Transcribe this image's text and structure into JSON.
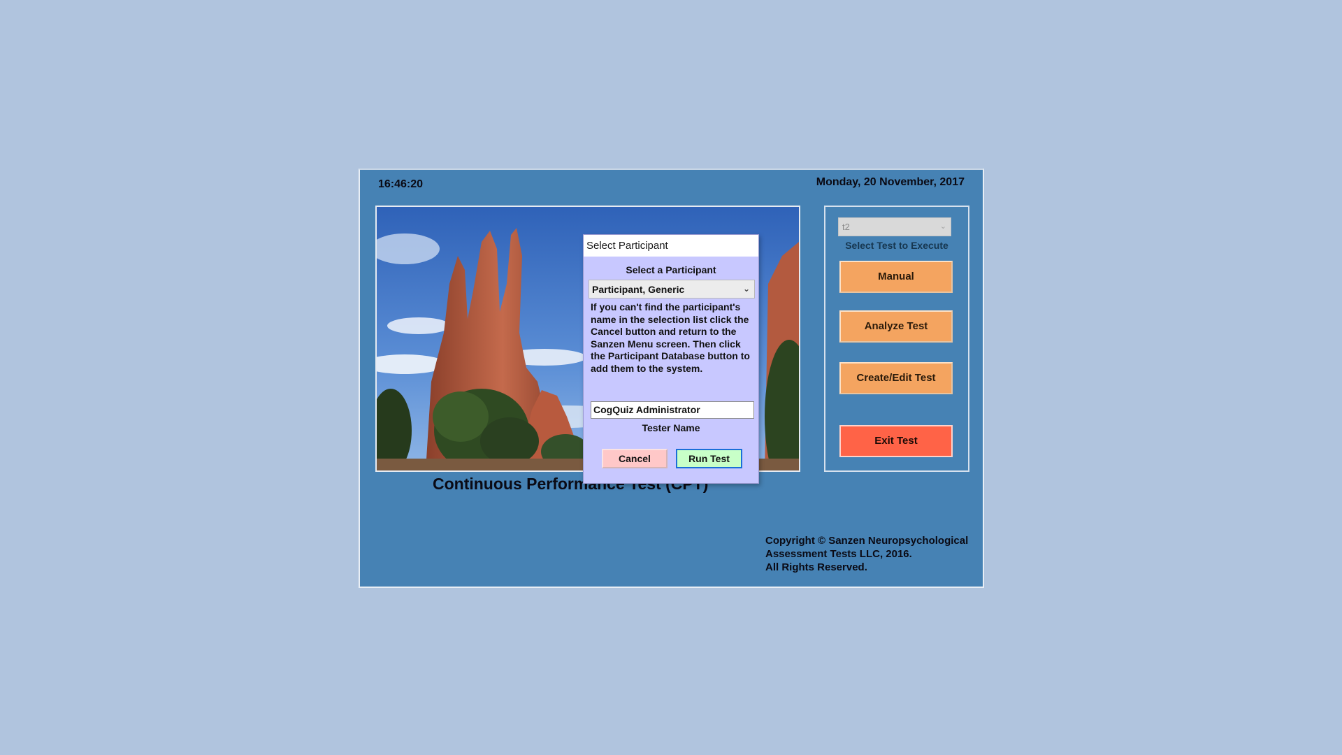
{
  "main": {
    "clock": "16:46:20",
    "date": "Monday, 20 November, 2017",
    "title": "Continuous Performance Test (CPT)",
    "photo_icon": "landscape-photo-rock-formations",
    "copyright_lines": [
      "Copyright © Sanzen Neuropsychological",
      "Assessment Tests LLC, 2016.",
      "All Rights Reserved."
    ]
  },
  "side_panel": {
    "test_select_value": "t2",
    "test_select_caption": "Select Test to Execute",
    "buttons": {
      "manual": "Manual",
      "analyze": "Analyze Test",
      "create_edit": "Create/Edit Test",
      "exit": "Exit Test"
    }
  },
  "dialog": {
    "title": "Select Participant",
    "heading": "Select a Participant",
    "participant_value": "Participant, Generic",
    "help_text": "If you can't find the participant's name in the selection list click the Cancel button and return to the Sanzen Menu screen. Then click the Participant Database button to add them to the system.",
    "tester_name_value": "CogQuiz Administrator",
    "tester_name_caption": "Tester Name",
    "cancel_label": "Cancel",
    "run_label": "Run Test"
  },
  "colors": {
    "desktop": "#b0c4de",
    "window": "#4682b4",
    "dialog": "#c8c8ff",
    "button_orange": "#f4a460",
    "button_exit": "#ff6347",
    "button_cancel": "#ffc8c8",
    "button_run": "#c8ffc8"
  }
}
